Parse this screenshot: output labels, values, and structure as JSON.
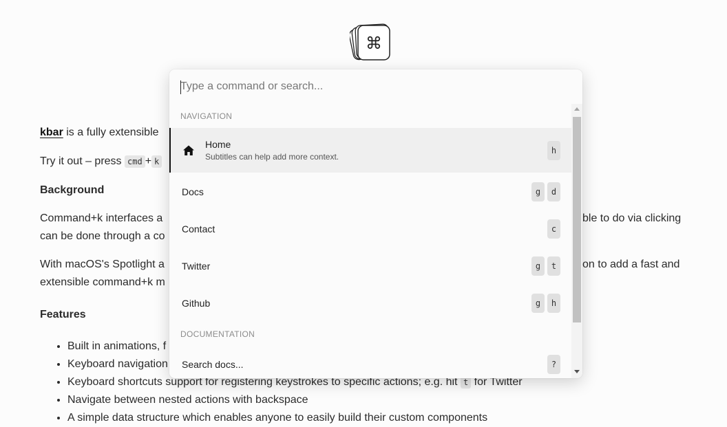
{
  "page": {
    "intro_link": "kbar",
    "intro_rest": " is a fully extensible",
    "try_prefix": "Try it out – press ",
    "try_key1": "cmd",
    "try_plus": "+",
    "try_key2": "k",
    "background_heading": "Background",
    "bg_line1_left": "Command+k interfaces a",
    "bg_line1_right": "ble to do via clicking",
    "bg_line2_left": "can be done through a co",
    "mac_line1_left": "With macOS's Spotlight a",
    "mac_line1_right": "on to add a fast and",
    "mac_line2_left": "extensible command+k m",
    "features_heading": "Features",
    "features": [
      "Built in animations, f",
      "Keyboard navigation",
      "Keyboard shortcuts support for registering keystrokes to specific actions; e.g. hit",
      "Navigate between nested actions with backspace",
      "A simple data structure which enables anyone to easily build their custom components"
    ],
    "feature3_key": "t",
    "feature3_suffix": " for Twitter"
  },
  "palette": {
    "search_placeholder": "Type a command or search...",
    "search_value": "",
    "sections": [
      {
        "label": "NAVIGATION"
      },
      {
        "label": "DOCUMENTATION"
      }
    ],
    "items": [
      {
        "title": "Home",
        "subtitle": "Subtitles can help add more context.",
        "icon": "home-icon",
        "shortcut": [
          "h"
        ],
        "active": true
      },
      {
        "title": "Docs",
        "shortcut": [
          "g",
          "d"
        ]
      },
      {
        "title": "Contact",
        "shortcut": [
          "c"
        ]
      },
      {
        "title": "Twitter",
        "shortcut": [
          "g",
          "t"
        ]
      },
      {
        "title": "Github",
        "shortcut": [
          "g",
          "h"
        ]
      },
      {
        "title": "Search docs...",
        "shortcut": [
          "?"
        ]
      }
    ]
  }
}
